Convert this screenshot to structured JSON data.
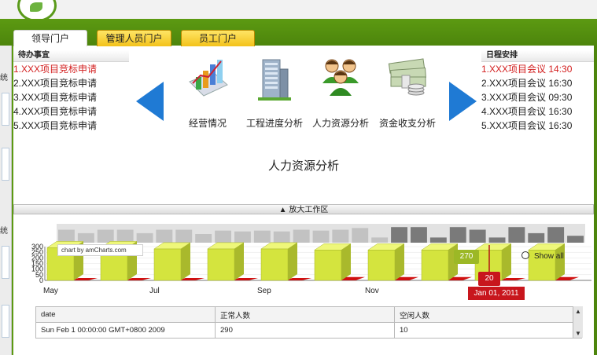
{
  "tabs": [
    {
      "label": "领导门户",
      "active": true
    },
    {
      "label": "管理人员门户",
      "active": false
    },
    {
      "label": "员工门户",
      "active": false
    }
  ],
  "left_strip": {
    "labels": [
      "统",
      "统"
    ]
  },
  "todo": {
    "title": "待办事宜",
    "items": [
      "1.XXX项目竞标申请",
      "2.XXX项目竞标申请",
      "3.XXX项目竞标申请",
      "4.XXX项目竞标申请",
      "5.XXX项目竞标申请"
    ]
  },
  "schedule": {
    "title": "日程安排",
    "items": [
      "1.XXX项目会议 14:30",
      "2.XXX项目会议 16:30",
      "3.XXX项目会议 09:30",
      "4.XXX项目会议 16:30",
      "5.XXX项目会议 16:30"
    ]
  },
  "modules": [
    {
      "label": "经营情况",
      "icon": "bar-chart-icon"
    },
    {
      "label": "工程进度分析",
      "icon": "building-icon"
    },
    {
      "label": "人力资源分析",
      "icon": "people-icon"
    },
    {
      "label": "资金收支分析",
      "icon": "money-icon"
    }
  ],
  "section_title": "人力资源分析",
  "expand_bar": "▲ 放大工作区",
  "chart_data": {
    "type": "bar",
    "credit": "chart by amCharts.com",
    "show_all": "Show all",
    "y_ticks": [
      "300",
      "250",
      "200",
      "150",
      "100",
      "50",
      "0"
    ],
    "x_ticks": [
      "May",
      "Jul",
      "Sep",
      "Nov"
    ],
    "ylim": [
      0,
      300
    ],
    "series": [
      {
        "name": "正常人数",
        "color": "#d8e84a",
        "values": [
          290,
          290,
          280,
          280,
          280,
          270,
          270,
          270,
          270,
          270
        ]
      },
      {
        "name": "空闲人数",
        "color": "#e01818",
        "values": [
          10,
          10,
          20,
          20,
          20,
          30,
          30,
          30,
          20,
          30
        ]
      }
    ],
    "scroller_values": [
      0.75,
      0.55,
      0.75,
      0.75,
      0.55,
      0.75,
      0.75,
      0.5,
      0.7,
      0.65,
      0.7,
      0.65,
      0.75,
      0.7,
      0.75,
      0.85,
      0.3,
      0.9,
      0.9,
      0.3,
      0.9,
      0.75,
      0.3,
      0.9,
      0.55,
      0.9,
      0.4
    ],
    "balloon_value": "270",
    "balloon_value2": "20",
    "cursor_date": "Jan 01, 2011"
  },
  "table": {
    "headers": [
      "date",
      "正常人数",
      "空闲人数"
    ],
    "rows": [
      [
        "Sun Feb 1 00:00:00 GMT+0800 2009",
        "290",
        "10"
      ]
    ]
  }
}
